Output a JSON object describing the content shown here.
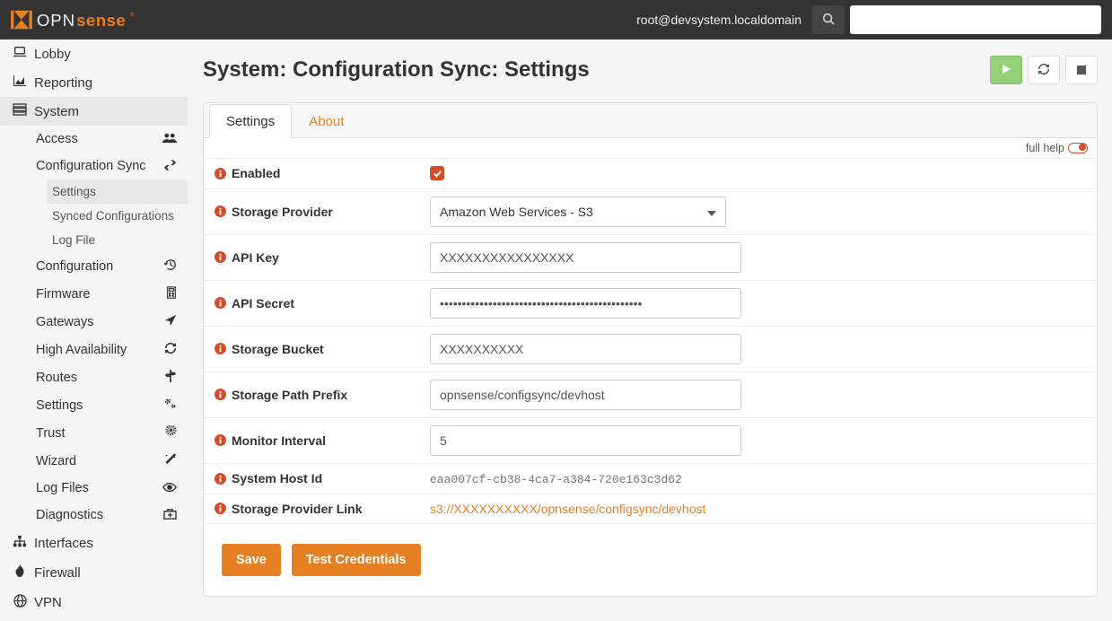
{
  "header": {
    "user": "root@devsystem.localdomain",
    "search_placeholder": ""
  },
  "sidebar": {
    "top": [
      {
        "icon_name": "laptop-icon",
        "label": "Lobby"
      },
      {
        "icon_name": "chart-area-icon",
        "label": "Reporting"
      },
      {
        "icon_name": "server-icon",
        "label": "System"
      }
    ],
    "system_items": [
      {
        "label": "Access",
        "right_icon_name": "users-icon"
      },
      {
        "label": "Configuration Sync",
        "right_icon_name": "exchange-icon"
      }
    ],
    "configsync_items": [
      {
        "label": "Settings",
        "active": true
      },
      {
        "label": "Synced Configurations",
        "active": false
      },
      {
        "label": "Log File",
        "active": false
      }
    ],
    "system_items_2": [
      {
        "label": "Configuration",
        "right_icon_name": "history-icon"
      },
      {
        "label": "Firmware",
        "right_icon_name": "calculator-icon"
      },
      {
        "label": "Gateways",
        "right_icon_name": "location-icon"
      },
      {
        "label": "High Availability",
        "right_icon_name": "refresh-icon"
      },
      {
        "label": "Routes",
        "right_icon_name": "signs-icon"
      },
      {
        "label": "Settings",
        "right_icon_name": "cogs-icon"
      },
      {
        "label": "Trust",
        "right_icon_name": "certificate-icon"
      },
      {
        "label": "Wizard",
        "right_icon_name": "magic-icon"
      },
      {
        "label": "Log Files",
        "right_icon_name": "eye-icon"
      },
      {
        "label": "Diagnostics",
        "right_icon_name": "briefcase-medical-icon"
      }
    ],
    "bottom": [
      {
        "icon_name": "sitemap-icon",
        "label": "Interfaces"
      },
      {
        "icon_name": "fire-icon",
        "label": "Firewall"
      },
      {
        "icon_name": "globe-icon",
        "label": "VPN"
      }
    ]
  },
  "page": {
    "title": "System: Configuration Sync: Settings",
    "tabs": {
      "settings": "Settings",
      "about": "About"
    },
    "full_help": "full help"
  },
  "form": {
    "enabled": {
      "label": "Enabled",
      "value": true
    },
    "provider": {
      "label": "Storage Provider",
      "value": "Amazon Web Services - S3"
    },
    "api_key": {
      "label": "API Key",
      "value": "XXXXXXXXXXXXXXXX"
    },
    "api_secret": {
      "label": "API Secret",
      "value": "••••••••••••••••••••••••••••••••••••••••••••••"
    },
    "bucket": {
      "label": "Storage Bucket",
      "value": "XXXXXXXXXX"
    },
    "prefix": {
      "label": "Storage Path Prefix",
      "value": "opnsense/configsync/devhost"
    },
    "interval": {
      "label": "Monitor Interval",
      "value": "5"
    },
    "hostid": {
      "label": "System Host Id",
      "value": "eaa007cf-cb38-4ca7-a384-720e163c3d62"
    },
    "link": {
      "label": "Storage Provider Link",
      "value": "s3://XXXXXXXXXX/opnsense/configsync/devhost"
    }
  },
  "buttons": {
    "save": "Save",
    "test": "Test Credentials"
  },
  "colors": {
    "accent": "#e67e22",
    "brand": "#d64c2b",
    "play": "#93d077"
  }
}
